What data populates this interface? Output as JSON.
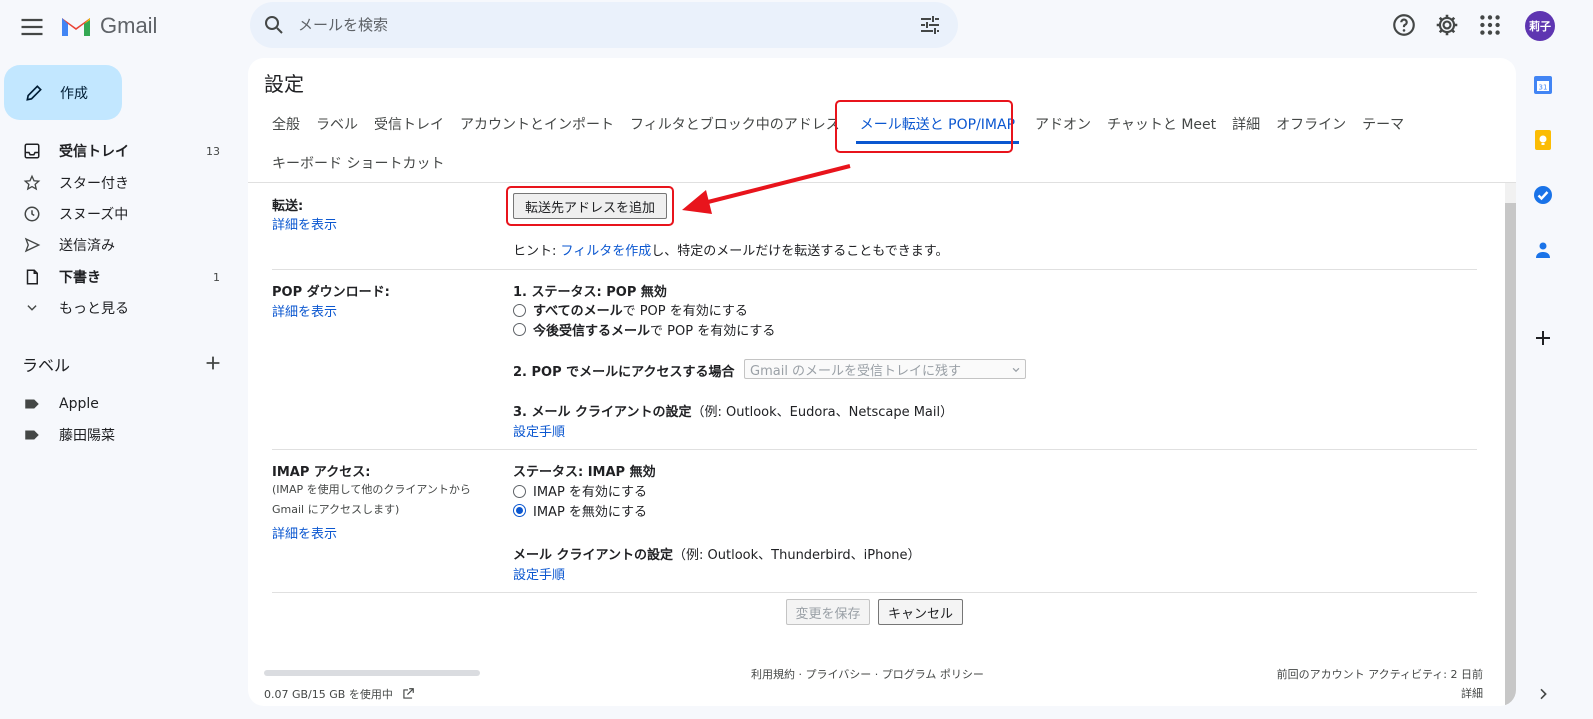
{
  "header": {
    "app_name": "Gmail",
    "search_placeholder": "メールを検索",
    "avatar_text": "莉子"
  },
  "sidebar": {
    "compose_label": "作成",
    "items": [
      {
        "label": "受信トレイ",
        "count": "13",
        "icon": "inbox-icon"
      },
      {
        "label": "スター付き",
        "count": "",
        "icon": "star-icon"
      },
      {
        "label": "スヌーズ中",
        "count": "",
        "icon": "clock-icon"
      },
      {
        "label": "送信済み",
        "count": "",
        "icon": "send-icon"
      },
      {
        "label": "下書き",
        "count": "1",
        "icon": "draft-icon"
      },
      {
        "label": "もっと見る",
        "count": "",
        "icon": "chevron-down-icon"
      }
    ],
    "labels_heading": "ラベル",
    "labels": [
      "Apple",
      "藤田陽菜"
    ]
  },
  "settings": {
    "title": "設定",
    "tabs": [
      "全般",
      "ラベル",
      "受信トレイ",
      "アカウントとインポート",
      "フィルタとブロック中のアドレス",
      "メール転送と POP/IMAP",
      "アドオン",
      "チャットと Meet",
      "詳細",
      "オフライン",
      "テーマ"
    ],
    "tabs_row2": [
      "キーボード ショートカット"
    ],
    "active_tab": "メール転送と POP/IMAP",
    "forwarding": {
      "label": "転送:",
      "details_link": "詳細を表示",
      "add_button": "転送先アドレスを追加",
      "hint_prefix": "ヒント: ",
      "hint_link": "フィルタを作成",
      "hint_suffix": "し、特定のメールだけを転送することもできます。"
    },
    "pop": {
      "label": "POP ダウンロード:",
      "details_link": "詳細を表示",
      "status": "1. ステータス: POP 無効",
      "option1_bold": "すべてのメール",
      "option1_rest": "で POP を有効にする",
      "option2_bold": "今後受信するメール",
      "option2_rest": "で POP を有効にする",
      "access_label": "2. POP でメールにアクセスする場合",
      "access_select": "Gmail のメールを受信トレイに残す",
      "client_bold": "3. メール クライアントの設定",
      "client_rest": "（例: Outlook、Eudora、Netscape Mail）",
      "setup_link": "設定手順"
    },
    "imap": {
      "label": "IMAP アクセス:",
      "note1": "(IMAP を使用して他のクライアントから",
      "note2": "Gmail にアクセスします)",
      "details_link": "詳細を表示",
      "status": "ステータス: IMAP 無効",
      "option_enable": "IMAP を有効にする",
      "option_disable": "IMAP を無効にする",
      "client_bold": "メール クライアントの設定",
      "client_rest": "（例: Outlook、Thunderbird、iPhone）",
      "setup_link": "設定手順"
    },
    "save_button": "変更を保存",
    "cancel_button": "キャンセル"
  },
  "footer": {
    "storage": "0.07 GB/15 GB を使用中",
    "links": "利用規約 · プライバシー · プログラム ポリシー",
    "activity": "前回のアカウント アクティビティ: 2 日前",
    "details": "詳細"
  },
  "colors": {
    "accent": "#0b57d0",
    "annotation": "#e8141c",
    "compose_bg": "#c2e7ff",
    "avatar_bg": "#5e35b1"
  }
}
